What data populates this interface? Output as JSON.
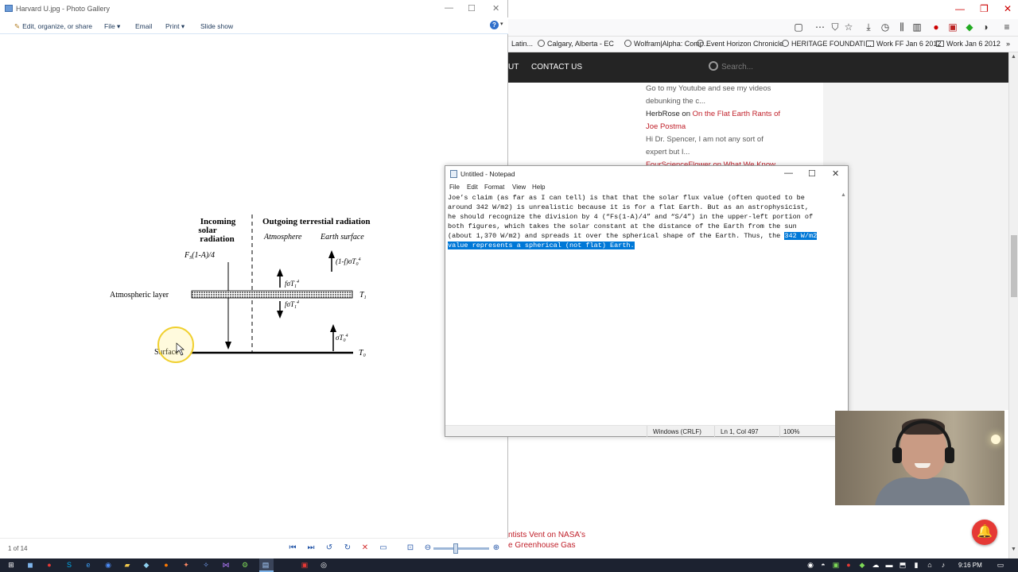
{
  "gallery": {
    "title": "Harvard U.jpg - Photo Gallery",
    "menu": [
      {
        "label": "Edit, organize, or share"
      },
      {
        "label": "File ▾"
      },
      {
        "label": "Email"
      },
      {
        "label": "Print ▾"
      },
      {
        "label": "Slide show"
      }
    ],
    "counter": "1 of 14",
    "diagram": {
      "incoming_header": "Incoming solar radiation",
      "incoming_l1": "Incoming",
      "incoming_l2": "solar",
      "incoming_l3": "radiation",
      "outgoing_header": "Outgoing terrestial radiation",
      "col_atmosphere": "Atmosphere",
      "col_earth_surface": "Earth surface",
      "incoming_flux": "F",
      "incoming_flux_sub": "S",
      "incoming_flux_rest": "(1-A)/4",
      "atmo_layer_label": "Atmospheric layer",
      "surface_label": "Surface",
      "T1": "T",
      "T1_sub": "1",
      "T0": "T",
      "T0_sub": "0",
      "top_right_flux": "(1-f)σT",
      "atmo_up_flux": "fσT",
      "atmo_down_flux": "fσT",
      "surface_flux": "σT",
      "sub0": "0",
      "sub1": "1",
      "sup4": "4"
    }
  },
  "browser": {
    "bookmarks": [
      {
        "label": "Latin...",
        "kind": "site"
      },
      {
        "label": "Calgary, Alberta - EC",
        "kind": "site"
      },
      {
        "label": "Wolfram|Alpha: Comp...",
        "kind": "site"
      },
      {
        "label": "Event Horizon Chronicle",
        "kind": "site"
      },
      {
        "label": "HERITAGE FOUNDATI...",
        "kind": "site"
      },
      {
        "label": "Work FF Jan 6 2012",
        "kind": "folder"
      },
      {
        "label": "Work Jan 6 2012",
        "kind": "folder"
      }
    ],
    "nav": {
      "partial_item": "UT",
      "contact": "CONTACT US",
      "search_placeholder": "Search..."
    },
    "comments": {
      "c1_text_a": "Go to my Youtube and see my videos",
      "c1_text_b": "debunking the c...",
      "c2_author": "HerbRose",
      "c2_on": " on ",
      "c2_link_a": "On the Flat Earth Rants of",
      "c2_link_b": "Joe Postma",
      "c3_text_a": "Hi Dr. Spencer, I am not any sort of",
      "c3_text_b": "expert but I...",
      "c4_partial": "FourScienceFlower on What We Know"
    },
    "bottom_news_a": "ntists Vent on NASA's",
    "bottom_news_b": "e Greenhouse Gas"
  },
  "notepad": {
    "title": "Untitled - Notepad",
    "menu": [
      "File",
      "Edit",
      "Format",
      "View",
      "Help"
    ],
    "lines": [
      "Joe’s claim (as far as I can tell) is that that the solar flux value (often quoted to be",
      "around 342 W/m2) is unrealistic because it is for a flat Earth. But as an astrophysicist,",
      "he should recognize the division by 4 (“Fs(1-A)/4” and “S/4”) in the upper-left portion of",
      "both figures, which takes the solar constant at the distance of the Earth from the sun",
      "(about 1,370 W/m2) and spreads it over the spherical shape of the Earth. Thus, the "
    ],
    "sel_line5": "342 W/m2",
    "sel_line6": "value represents a spherical (not flat) Earth.",
    "status": {
      "eol": "Windows (CRLF)",
      "pos": "Ln 1, Col 497",
      "zoom": "100%"
    }
  },
  "taskbar": {
    "time": "9:16 PM"
  }
}
